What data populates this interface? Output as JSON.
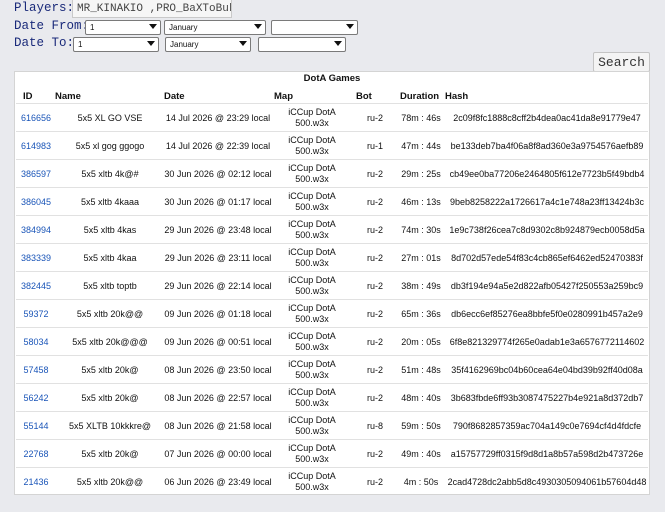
{
  "filters": {
    "players_label": "Players:",
    "players_value": "MR_KINAKIO ,PRO_BaXToBuk",
    "date_from_label": "Date From:",
    "date_to_label": "Date To:",
    "from_day": "1",
    "from_month": "January",
    "from_year": "",
    "to_day": "1",
    "to_month": "January",
    "to_year": ""
  },
  "search_label": "Search",
  "table": {
    "title": "DotA Games",
    "headers": {
      "id": "ID",
      "name": "Name",
      "date": "Date",
      "map": "Map",
      "bot": "Bot",
      "duration": "Duration",
      "hash": "Hash"
    },
    "rows": [
      {
        "id": "616656",
        "name": "5x5 XL GO VSE",
        "date": "14 Jul 2026 @ 23:29 local",
        "map1": "iCCup DotA",
        "map2": "500.w3x",
        "bot": "ru-2",
        "duration": "78m : 46s",
        "hash": "2c09f8fc1888c8cff2b4dea0ac41da8e91779e47"
      },
      {
        "id": "614983",
        "name": "5x5 xl gog ggogo",
        "date": "14 Jul 2026 @ 22:39 local",
        "map1": "iCCup DotA",
        "map2": "500.w3x",
        "bot": "ru-1",
        "duration": "47m : 44s",
        "hash": "be133deb7ba4f06a8f8ad360e3a9754576aefb89"
      },
      {
        "id": "386597",
        "name": "5x5 xltb 4k@#",
        "date": "30 Jun 2026 @ 02:12 local",
        "map1": "iCCup DotA",
        "map2": "500.w3x",
        "bot": "ru-2",
        "duration": "29m : 25s",
        "hash": "cb49ee0ba77206e2464805f612e7723b5f49bdb4"
      },
      {
        "id": "386045",
        "name": "5x5 xltb 4kaaa",
        "date": "30 Jun 2026 @ 01:17 local",
        "map1": "iCCup DotA",
        "map2": "500.w3x",
        "bot": "ru-2",
        "duration": "46m : 13s",
        "hash": "9beb8258222a1726617a4c1e748a23ff13424b3c"
      },
      {
        "id": "384994",
        "name": "5x5 xltb 4kas",
        "date": "29 Jun 2026 @ 23:48 local",
        "map1": "iCCup DotA",
        "map2": "500.w3x",
        "bot": "ru-2",
        "duration": "74m : 30s",
        "hash": "1e9c738f26cea7c8d9302c8b924879ecb0058d5a"
      },
      {
        "id": "383339",
        "name": "5x5 xltb 4kaa",
        "date": "29 Jun 2026 @ 23:11 local",
        "map1": "iCCup DotA",
        "map2": "500.w3x",
        "bot": "ru-2",
        "duration": "27m : 01s",
        "hash": "8d702d57ede54f83c4cb865ef6462ed52470383f"
      },
      {
        "id": "382445",
        "name": "5x5 xltb toptb",
        "date": "29 Jun 2026 @ 22:14 local",
        "map1": "iCCup DotA",
        "map2": "500.w3x",
        "bot": "ru-2",
        "duration": "38m : 49s",
        "hash": "db3f194e94a5e2d822afb05427f250553a259bc9"
      },
      {
        "id": "59372",
        "name": "5x5 xltb 20k@@",
        "date": "09 Jun 2026 @ 01:18 local",
        "map1": "iCCup DotA",
        "map2": "500.w3x",
        "bot": "ru-2",
        "duration": "65m : 36s",
        "hash": "db6ecc6ef85276ea8bbfe5f0e0280991b457a2e9"
      },
      {
        "id": "58034",
        "name": "5x5 xltb 20k@@@",
        "date": "09 Jun 2026 @ 00:51 local",
        "map1": "iCCup DotA",
        "map2": "500.w3x",
        "bot": "ru-2",
        "duration": "20m : 05s",
        "hash": "6f8e821329774f265e0adab1e3a6576772114602"
      },
      {
        "id": "57458",
        "name": "5x5 xltb 20k@",
        "date": "08 Jun 2026 @ 23:50 local",
        "map1": "iCCup DotA",
        "map2": "500.w3x",
        "bot": "ru-2",
        "duration": "51m : 48s",
        "hash": "35f4162969bc04b60cea64e04bd39b92ff40d08a"
      },
      {
        "id": "56242",
        "name": "5x5 xltb 20k@",
        "date": "08 Jun 2026 @ 22:57 local",
        "map1": "iCCup DotA",
        "map2": "500.w3x",
        "bot": "ru-2",
        "duration": "48m : 40s",
        "hash": "3b683fbde6ff93b3087475227b4e921a8d372db7"
      },
      {
        "id": "55144",
        "name": "5x5 XLTB 10kkkre@",
        "date": "08 Jun 2026 @ 21:58 local",
        "map1": "iCCup DotA",
        "map2": "500.w3x",
        "bot": "ru-8",
        "duration": "59m : 50s",
        "hash": "790f8682857359ac704a149c0e7694cf4d4fdcfe"
      },
      {
        "id": "22768",
        "name": "5x5 xltb 20k@",
        "date": "07 Jun 2026 @ 00:00 local",
        "map1": "iCCup DotA",
        "map2": "500.w3x",
        "bot": "ru-2",
        "duration": "49m : 40s",
        "hash": "a15757729ff0315f9d8d1a8b57a598d2b473726e"
      },
      {
        "id": "21436",
        "name": "5x5 xltb 20k@@",
        "date": "06 Jun 2026 @ 23:49 local",
        "map1": "iCCup DotA",
        "map2": "500.w3x",
        "bot": "ru-2",
        "duration": "4m : 50s",
        "hash": "2cad4728dc2abb5d8c4930305094061b57604d48"
      }
    ]
  }
}
